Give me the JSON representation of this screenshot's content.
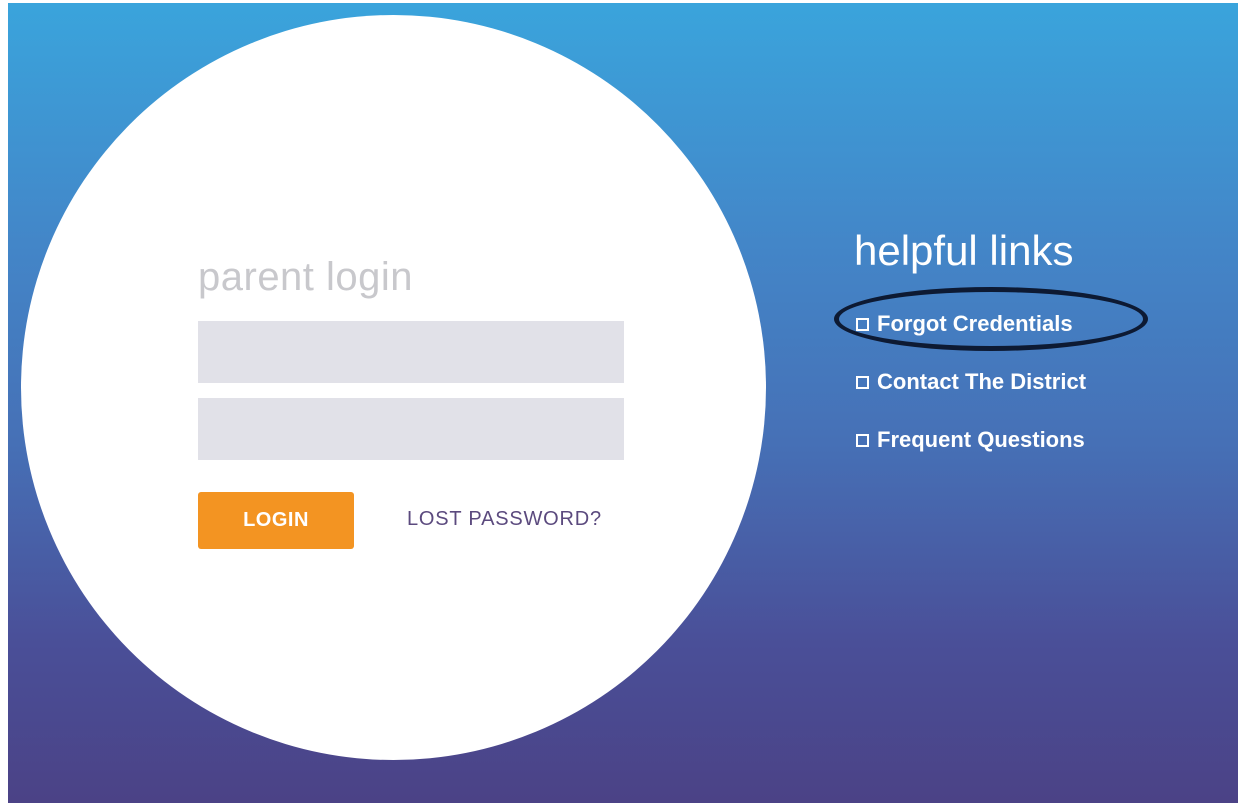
{
  "login": {
    "title": "parent login",
    "username_value": "",
    "password_value": "",
    "login_button": "LOGIN",
    "lost_password": "LOST PASSWORD?"
  },
  "helpful_links": {
    "title": "helpful links",
    "items": [
      {
        "label": "Forgot Credentials",
        "icon": "checkbox-square-icon",
        "highlighted": true
      },
      {
        "label": "Contact The District",
        "icon": "checkbox-square-icon",
        "highlighted": false
      },
      {
        "label": "Frequent Questions",
        "icon": "checkbox-square-icon",
        "highlighted": false
      }
    ]
  },
  "colors": {
    "gradient_top": "#3aa4dc",
    "gradient_bottom": "#4b4286",
    "login_button": "#f39422",
    "input_bg": "#e1e1e8",
    "lost_password_text": "#5b4a7e",
    "highlight_ring": "#0d1a33"
  }
}
